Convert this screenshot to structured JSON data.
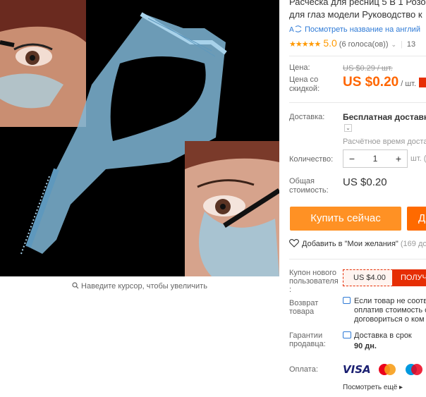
{
  "product": {
    "title_line1": "Расческа для ресниц 5 В 1 Розо",
    "title_line2": "для глаз модели Руководство к",
    "translate_link": "Посмотреть название на англий",
    "stars": "★★★★★",
    "rating": "5.0",
    "reviews": "(6 голоса(ов))",
    "orders": "13"
  },
  "price": {
    "label": "Цена:",
    "old": "US $0.29 / шт.",
    "discount_label_1": "Цена со",
    "discount_label_2": "скидкой:",
    "current": "US $0.20",
    "unit": "/ шт."
  },
  "shipping": {
    "label": "Доставка:",
    "method": "Бесплатная доставка",
    "dropdown": "⌄",
    "estimated": "Расчётное время доставки"
  },
  "quantity": {
    "label": "Количество:",
    "minus": "−",
    "value": "1",
    "plus": "+",
    "unit": "шт. ("
  },
  "total": {
    "label_1": "Общая",
    "label_2": "стоимость:",
    "value": "US $0.20"
  },
  "actions": {
    "buy_now": "Купить сейчас",
    "add_to_cart": "Д",
    "wishlist": "Добавить в \"Мои желания\"",
    "wishlist_count": "(169 до"
  },
  "coupon": {
    "label_1": "Купон нового",
    "label_2": "пользователя",
    "label_3": ":",
    "value": "US $4.00",
    "get": "ПОЛУЧ"
  },
  "returns": {
    "label_1": "Возврат",
    "label_2": "товара",
    "line1": "Если товар не соотв",
    "line2": "оплатив стоимость с",
    "line3": "договориться о ком"
  },
  "guarantee": {
    "label_1": "Гарантии",
    "label_2": "продавца:",
    "line1": "Доставка в срок",
    "line2": "90 дн."
  },
  "payment": {
    "label": "Оплата:",
    "visa": "VISA",
    "more": "Посмотреть ещё",
    "more_arrow": "▸"
  },
  "image": {
    "zoom_hint": "Наведите курсор, чтобы увеличить"
  },
  "colors": {
    "accent": "#ff6a00",
    "price": "#ff6600",
    "link": "#2e7ad6",
    "coupon": "#e62e04"
  }
}
